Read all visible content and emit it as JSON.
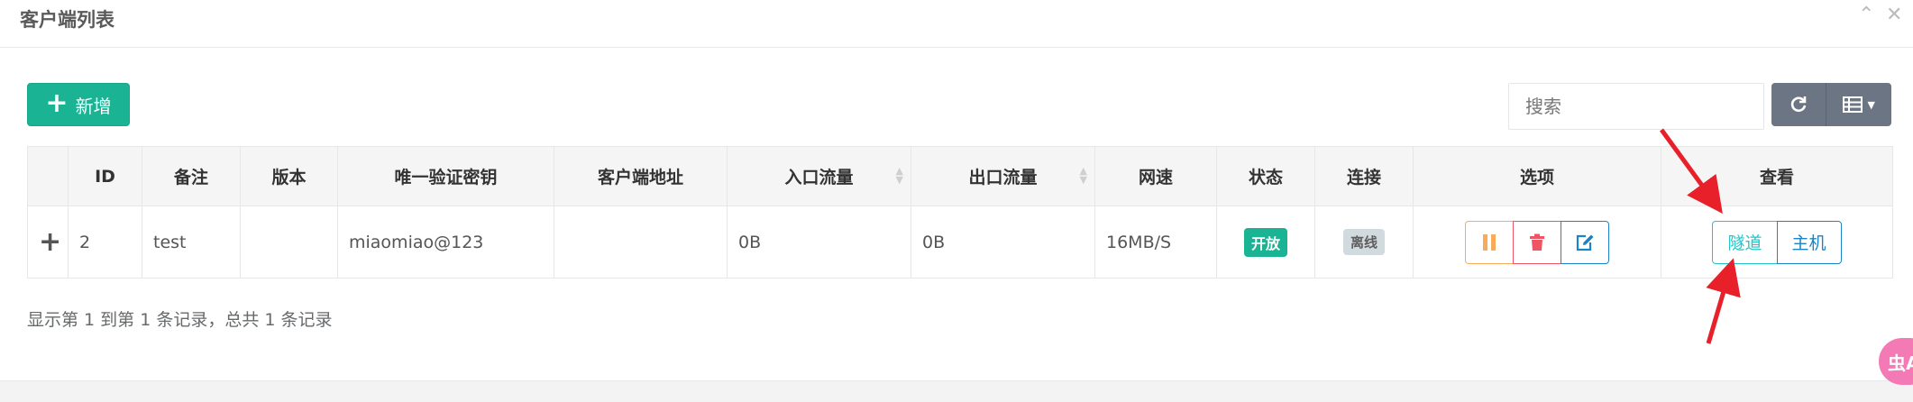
{
  "panel": {
    "title": "客户端列表"
  },
  "toolbar": {
    "add_label": "新增",
    "search_placeholder": "搜索"
  },
  "table": {
    "headers": [
      "",
      "ID",
      "备注",
      "版本",
      "唯一验证密钥",
      "客户端地址",
      "入口流量",
      "出口流量",
      "网速",
      "状态",
      "连接",
      "选项",
      "查看"
    ],
    "rows": [
      {
        "expander": "+",
        "id": "2",
        "remark": "test",
        "version": "",
        "key": "miaomiao@123",
        "address": "",
        "in_flow": "0B",
        "out_flow": "0B",
        "speed": "16MB/S",
        "status": "开放",
        "connection": "离线",
        "view_tunnel": "隧道",
        "view_host": "主机"
      }
    ]
  },
  "footer": {
    "summary": "显示第 1 到第 1 条记录，总共 1 条记录"
  },
  "floating": {
    "label": "虫A"
  },
  "colors": {
    "primary": "#1ab394",
    "info": "#23c6c8",
    "blue": "#1c84c6",
    "warning": "#f8ac59",
    "danger": "#ed5565",
    "annotation": "#e8202a"
  },
  "icons": [
    "plus-icon",
    "refresh-icon",
    "columns-icon",
    "pause-icon",
    "trash-icon",
    "edit-icon"
  ]
}
